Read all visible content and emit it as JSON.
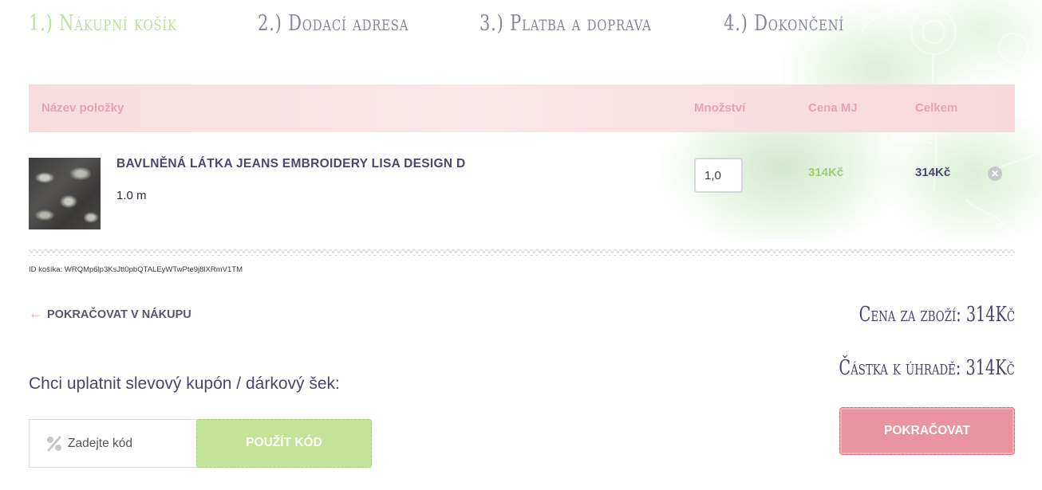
{
  "steps": [
    {
      "label": "1.) Nákupní košík",
      "active": true
    },
    {
      "label": "2.) Dodací adresa",
      "active": false
    },
    {
      "label": "3.) Platba a doprava",
      "active": false
    },
    {
      "label": "4.) Dokončení",
      "active": false
    }
  ],
  "table": {
    "headers": {
      "name": "Název položky",
      "quantity": "Množství",
      "unit_price": "Cena MJ",
      "total": "Celkem"
    },
    "rows": [
      {
        "name": "BAVLNĚNÁ LÁTKA JEANS EMBROIDERY LISA DESIGN D",
        "variant": "1.0 m",
        "quantity": "1,0",
        "unit_price": "314Kč",
        "total": "314Kč",
        "remove_icon": "close-circle-icon"
      }
    ]
  },
  "cart_id": "ID košíka: WRQMp6lp3KsJtt0pbQTALEyWTwPte9j8lXRmV1TM",
  "continue_shopping": {
    "arrow": "←",
    "label": "POKRAČOVAT V NÁKUPU"
  },
  "summary": {
    "goods_price": "Cena za zboží: 314Kč",
    "amount_due": "Částka k úhradě: 314Kč"
  },
  "coupon": {
    "label": "Chci uplatnit slevový kupón / dárkový šek:",
    "placeholder": "Zadejte kód",
    "icon": "percent-icon",
    "apply_label": "POUŽÍT KÓD"
  },
  "proceed_label": "POKRAČOVAT",
  "colors": {
    "accent_green": "#bfe09a",
    "accent_pink": "#ea949f",
    "text_purple": "#4d4570",
    "header_pink": "#f7dcdf"
  }
}
